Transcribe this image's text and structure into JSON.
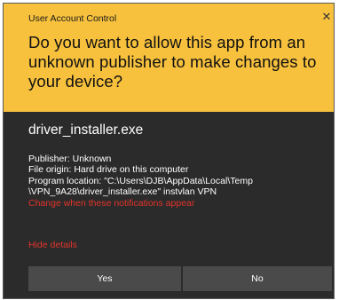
{
  "dialog": {
    "title": "User Account Control",
    "close_glyph": "✕",
    "question": "Do you want to allow this app from an unknown publisher to make changes to your device?",
    "app_name": "driver_installer.exe",
    "details": {
      "publisher": "Publisher: Unknown",
      "file_origin": "File origin: Hard drive on this computer",
      "program_location_1": "Program location: \"C:\\Users\\DJB\\AppData\\Local\\Temp",
      "program_location_2": "\\VPN_9A28\\driver_installer.exe\" instvlan VPN",
      "change_notifications_link": "Change when these notifications appear"
    },
    "hide_details_link": "Hide details",
    "buttons": {
      "yes": "Yes",
      "no": "No"
    }
  },
  "colors": {
    "banner": "#f7c13d",
    "body": "#2b2b2b",
    "button": "#4a4a4a",
    "link_red": "#e0352b",
    "text_light": "#ffffff"
  }
}
